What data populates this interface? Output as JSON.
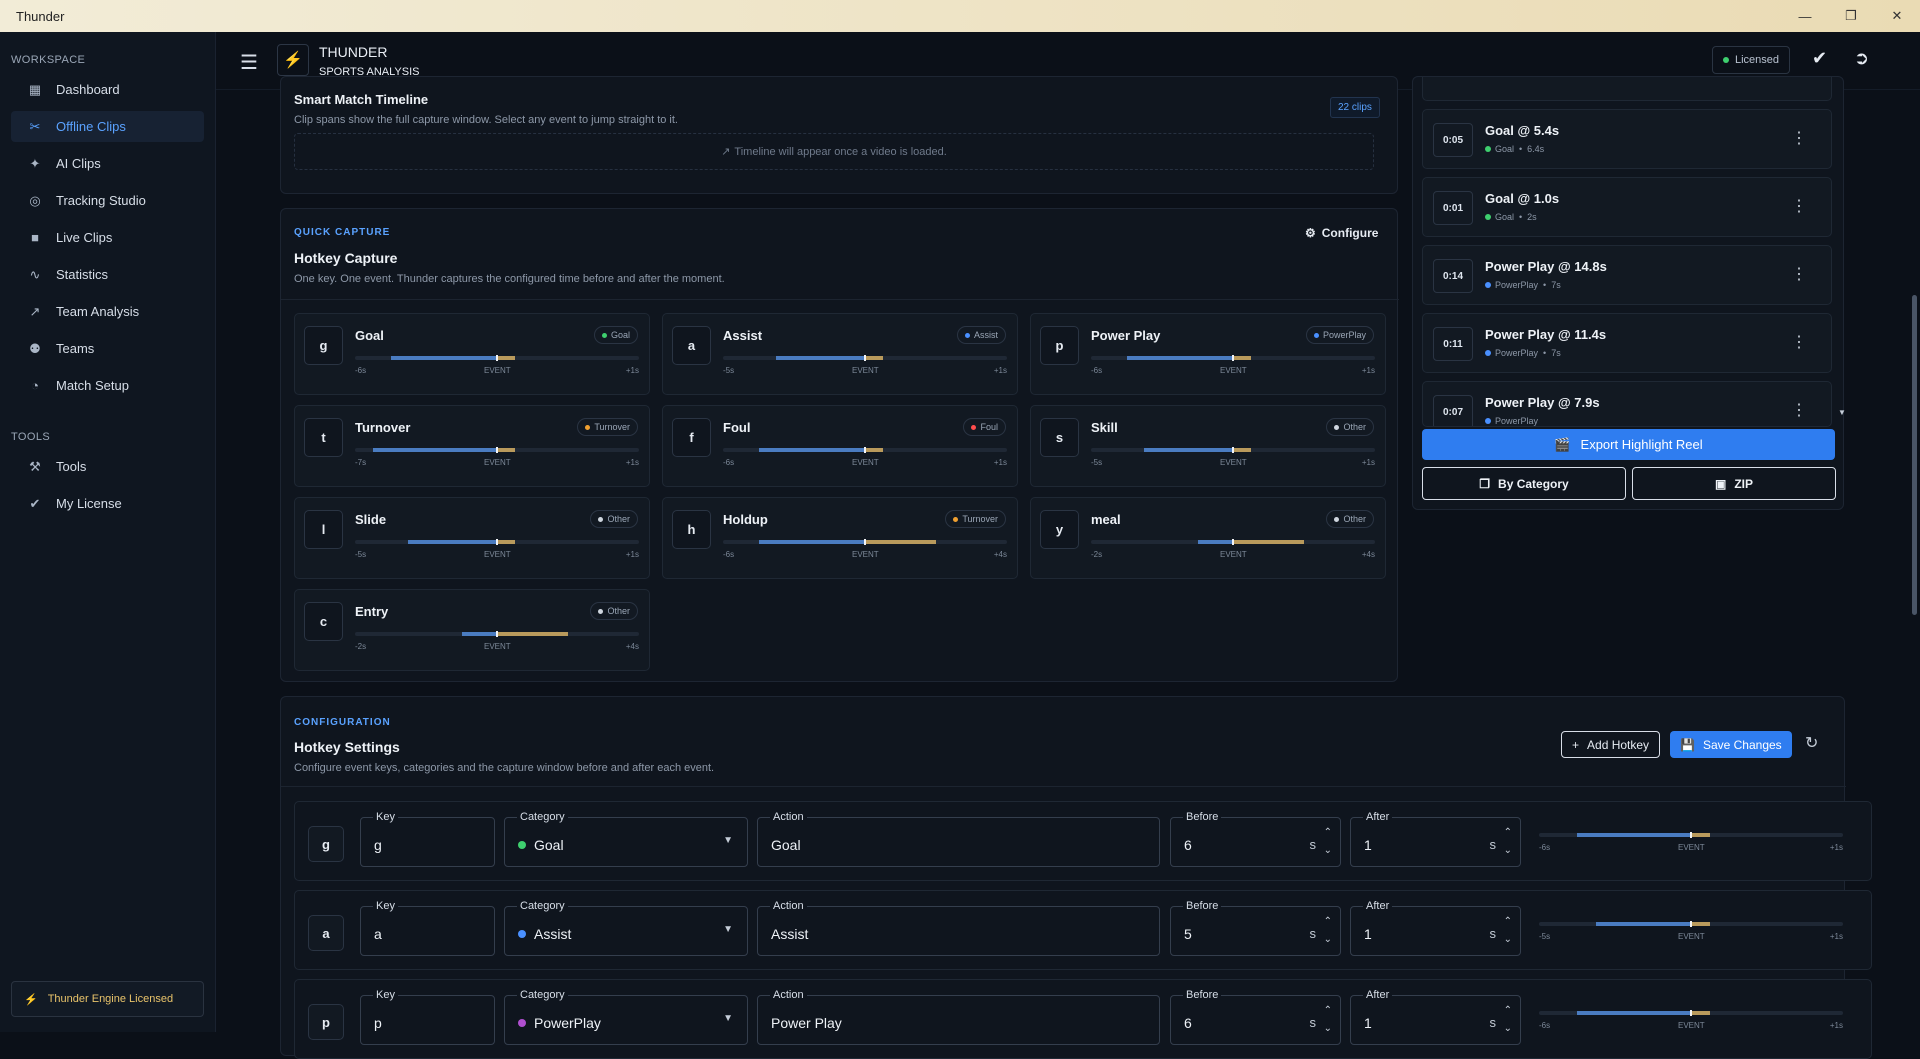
{
  "window": {
    "title": "Thunder"
  },
  "sidebar": {
    "workspace_label": "WORKSPACE",
    "items": [
      {
        "label": "Dashboard",
        "icon": "dashboard-icon"
      },
      {
        "label": "Offline Clips",
        "icon": "scissors-icon"
      },
      {
        "label": "AI Clips",
        "icon": "sparkle-icon"
      },
      {
        "label": "Tracking Studio",
        "icon": "tracking-icon"
      },
      {
        "label": "Live Clips",
        "icon": "video-icon"
      },
      {
        "label": "Statistics",
        "icon": "stats-icon"
      },
      {
        "label": "Team Analysis",
        "icon": "chart-line-icon"
      },
      {
        "label": "Teams",
        "icon": "teams-icon"
      },
      {
        "label": "Match Setup",
        "icon": "whistle-icon"
      }
    ],
    "tools_label": "TOOLS",
    "tools": [
      {
        "label": "Tools",
        "icon": "wrench-icon"
      },
      {
        "label": "My License",
        "icon": "verified-icon"
      }
    ],
    "footer": "Thunder Engine Licensed"
  },
  "header": {
    "brand": "THUNDER",
    "sub": "SPORTS ANALYSIS",
    "licensed": "Licensed"
  },
  "timeline": {
    "title": "Smart Match Timeline",
    "subtitle": "Clip spans show the full capture window. Select any event to jump straight to it.",
    "badge": "22 clips",
    "empty": "Timeline will appear once a video is loaded."
  },
  "quick_capture": {
    "label": "QUICK CAPTURE",
    "title": "Hotkey Capture",
    "subtitle": "One key. One event. Thunder captures the configured time before and after the moment.",
    "configure": "Configure",
    "event_label": "EVENT",
    "tiles": [
      {
        "key": "g",
        "name": "Goal",
        "cat": "Goal",
        "color": "#3ecf6e",
        "before": "-6s",
        "after": "+1s",
        "b": 6,
        "a": 1
      },
      {
        "key": "a",
        "name": "Assist",
        "cat": "Assist",
        "color": "#4a90ff",
        "before": "-5s",
        "after": "+1s",
        "b": 5,
        "a": 1
      },
      {
        "key": "p",
        "name": "Power Play",
        "cat": "PowerPlay",
        "color": "#4a90ff",
        "before": "-6s",
        "after": "+1s",
        "b": 6,
        "a": 1
      },
      {
        "key": "t",
        "name": "Turnover",
        "cat": "Turnover",
        "color": "#f0a030",
        "before": "-7s",
        "after": "+1s",
        "b": 7,
        "a": 1
      },
      {
        "key": "f",
        "name": "Foul",
        "cat": "Foul",
        "color": "#ff4d4d",
        "before": "-6s",
        "after": "+1s",
        "b": 6,
        "a": 1
      },
      {
        "key": "s",
        "name": "Skill",
        "cat": "Other",
        "color": "#cfd6df",
        "before": "-5s",
        "after": "+1s",
        "b": 5,
        "a": 1
      },
      {
        "key": "l",
        "name": "Slide",
        "cat": "Other",
        "color": "#cfd6df",
        "before": "-5s",
        "after": "+1s",
        "b": 5,
        "a": 1
      },
      {
        "key": "h",
        "name": "Holdup",
        "cat": "Turnover",
        "color": "#f0a030",
        "before": "-6s",
        "after": "+4s",
        "b": 6,
        "a": 4
      },
      {
        "key": "y",
        "name": "meal",
        "cat": "Other",
        "color": "#cfd6df",
        "before": "-2s",
        "after": "+4s",
        "b": 2,
        "a": 4
      },
      {
        "key": "c",
        "name": "Entry",
        "cat": "Other",
        "color": "#cfd6df",
        "before": "-2s",
        "after": "+4s",
        "b": 2,
        "a": 4
      }
    ]
  },
  "clips": {
    "items": [
      {
        "time": "0:05",
        "name": "Goal @ 5.4s",
        "cat": "Goal",
        "color": "#3ecf6e",
        "dur": "6.4s"
      },
      {
        "time": "0:01",
        "name": "Goal @ 1.0s",
        "cat": "Goal",
        "color": "#3ecf6e",
        "dur": "2s"
      },
      {
        "time": "0:14",
        "name": "Power Play @ 14.8s",
        "cat": "PowerPlay",
        "color": "#4a90ff",
        "dur": "7s"
      },
      {
        "time": "0:11",
        "name": "Power Play @ 11.4s",
        "cat": "PowerPlay",
        "color": "#4a90ff",
        "dur": "7s"
      },
      {
        "time": "0:07",
        "name": "Power Play @ 7.9s",
        "cat": "PowerPlay",
        "color": "#4a90ff",
        "dur": ""
      }
    ],
    "export": "Export Highlight Reel",
    "by_category": "By Category",
    "zip": "ZIP"
  },
  "config": {
    "label": "CONFIGURATION",
    "title": "Hotkey Settings",
    "subtitle": "Configure event keys, categories and the capture window before and after each event.",
    "add": "Add Hotkey",
    "save": "Save Changes",
    "labels": {
      "key": "Key",
      "category": "Category",
      "action": "Action",
      "before": "Before",
      "after": "After",
      "unit": "s",
      "event": "EVENT"
    },
    "rows": [
      {
        "key": "g",
        "category": "Goal",
        "color": "#3ecf6e",
        "action": "Goal",
        "before": "6",
        "after": "1",
        "bl": "-6s",
        "al": "+1s",
        "b": 6,
        "a": 1
      },
      {
        "key": "a",
        "category": "Assist",
        "color": "#4a90ff",
        "action": "Assist",
        "before": "5",
        "after": "1",
        "bl": "-5s",
        "al": "+1s",
        "b": 5,
        "a": 1
      },
      {
        "key": "p",
        "category": "PowerPlay",
        "color": "#b04fd0",
        "action": "Power Play",
        "before": "6",
        "after": "1",
        "bl": "-6s",
        "al": "+1s",
        "b": 6,
        "a": 1
      }
    ]
  }
}
